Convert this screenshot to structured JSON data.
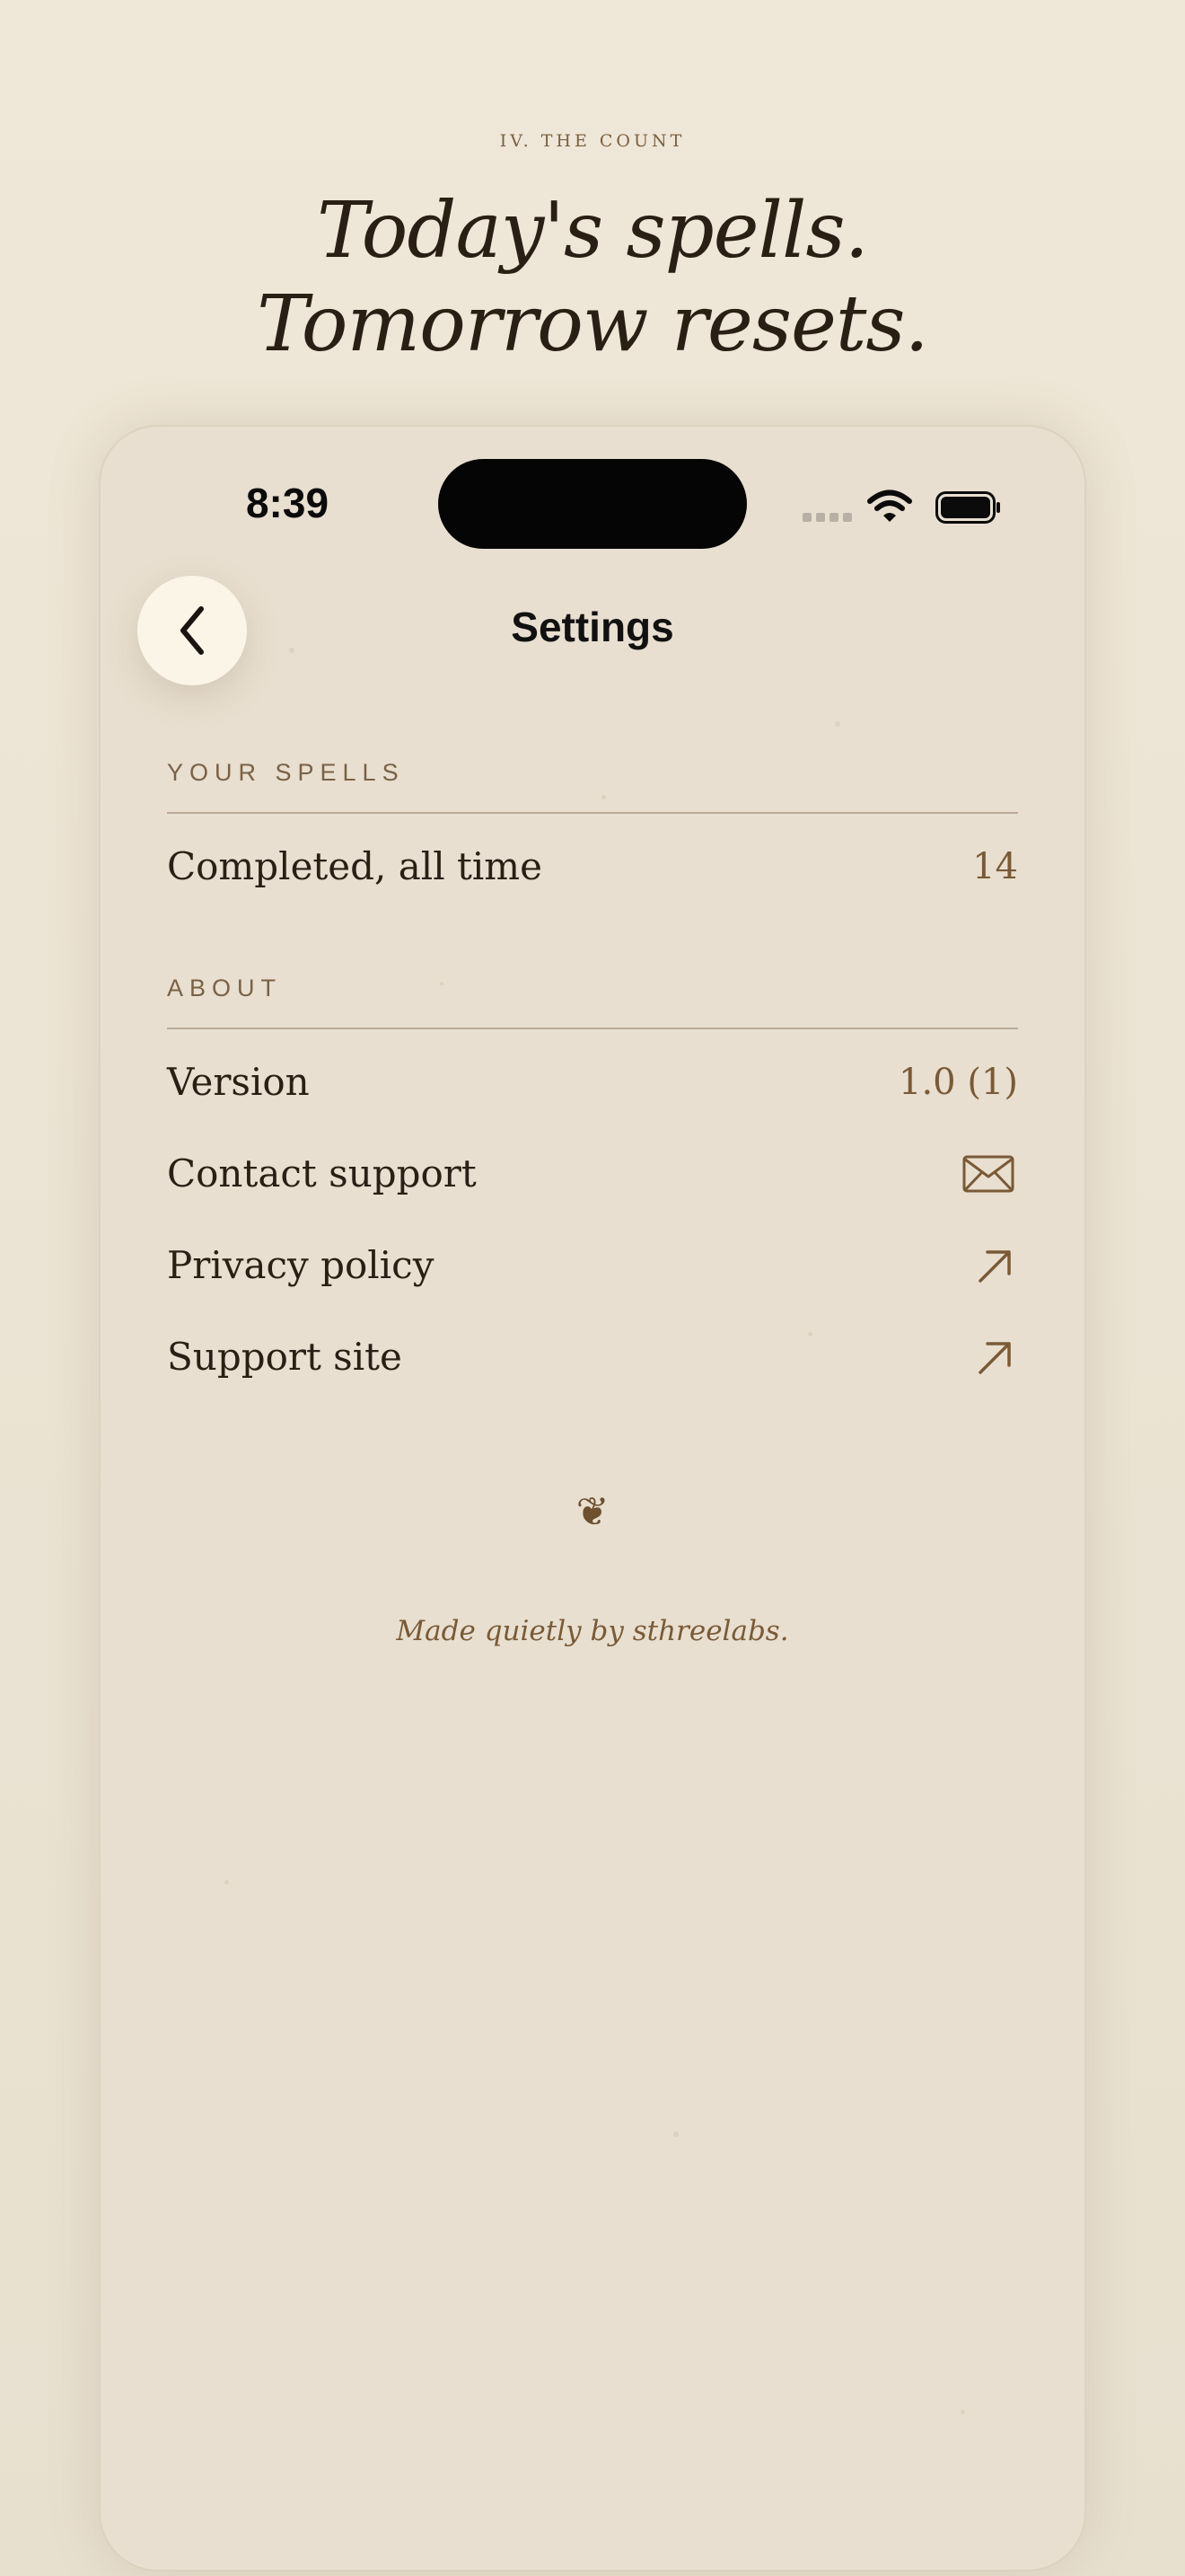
{
  "header": {
    "eyebrow": "IV. THE COUNT",
    "headline_line1": "Today's spells.",
    "headline_line2": "Tomorrow resets."
  },
  "status_bar": {
    "time": "8:39",
    "icons": [
      "cellular-signal-icon",
      "wifi-icon",
      "battery-icon"
    ]
  },
  "nav": {
    "back_icon": "chevron-left-icon",
    "title": "Settings"
  },
  "sections": {
    "spells": {
      "heading": "YOUR SPELLS",
      "rows": [
        {
          "label": "Completed, all time",
          "value": "14"
        }
      ]
    },
    "about": {
      "heading": "ABOUT",
      "rows": [
        {
          "label": "Version",
          "value": "1.0 (1)"
        },
        {
          "label": "Contact support",
          "icon": "envelope-icon"
        },
        {
          "label": "Privacy policy",
          "icon": "arrow-up-right-icon"
        },
        {
          "label": "Support site",
          "icon": "arrow-up-right-icon"
        }
      ]
    }
  },
  "footer": {
    "ornament": "❦",
    "credit": "Made quietly by sthreelabs."
  },
  "colors": {
    "background": "#ece4d5",
    "card": "#e8dfd0",
    "accent": "#7a5a36",
    "text": "#2a1f15",
    "rule": "#b9ab98"
  }
}
